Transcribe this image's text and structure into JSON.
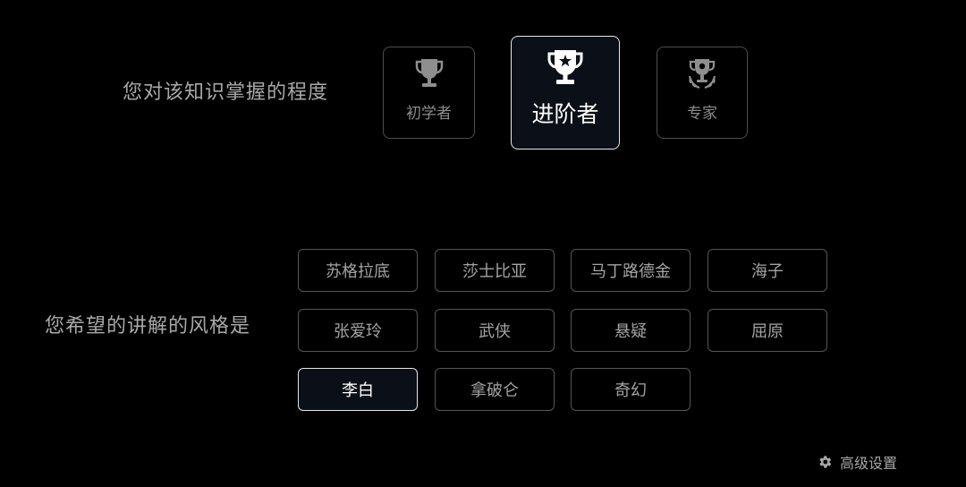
{
  "knowledge_section": {
    "question": "您对该知识掌握的程度",
    "levels": [
      {
        "label": "初学者",
        "icon": "trophy-icon",
        "selected": false
      },
      {
        "label": "进阶者",
        "icon": "trophy-star-icon",
        "selected": true
      },
      {
        "label": "专家",
        "icon": "trophy-laurel-icon",
        "selected": false
      }
    ]
  },
  "style_section": {
    "question": "您希望的讲解的风格是",
    "options": [
      {
        "label": "苏格拉底",
        "selected": false
      },
      {
        "label": "莎士比亚",
        "selected": false
      },
      {
        "label": "马丁路德金",
        "selected": false
      },
      {
        "label": "海子",
        "selected": false
      },
      {
        "label": "张爱玲",
        "selected": false
      },
      {
        "label": "武侠",
        "selected": false
      },
      {
        "label": "悬疑",
        "selected": false
      },
      {
        "label": "屈原",
        "selected": false
      },
      {
        "label": "李白",
        "selected": true
      },
      {
        "label": "拿破仑",
        "selected": false
      },
      {
        "label": "奇幻",
        "selected": false
      }
    ]
  },
  "advanced_settings": {
    "label": "高级设置",
    "icon": "gear-icon"
  },
  "colors": {
    "background": "#000000",
    "selected_border": "#e6e6e6",
    "selected_fill": "#0b0f17",
    "muted_text": "#a3a3a3"
  }
}
